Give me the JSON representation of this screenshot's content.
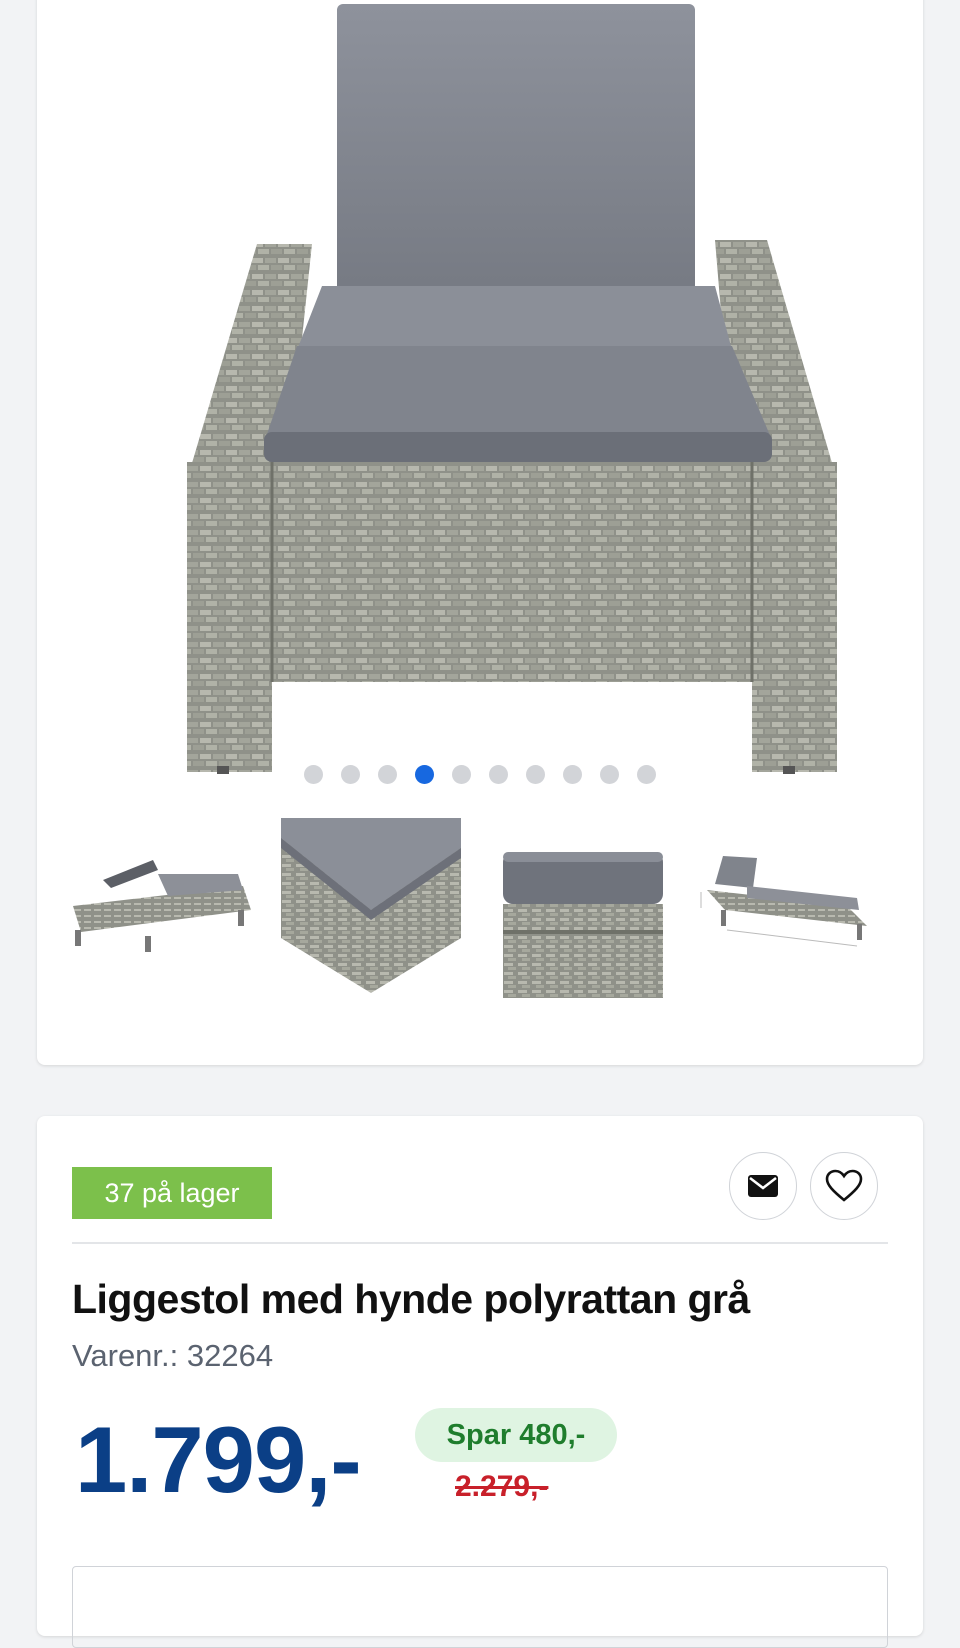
{
  "gallery": {
    "dot_count": 10,
    "active_dot_index": 3,
    "thumbnails": [
      {
        "icon": "lounger-storage-thumbnail"
      },
      {
        "icon": "lounger-corner-thumbnail"
      },
      {
        "icon": "lounger-cushion-closeup-thumbnail"
      },
      {
        "icon": "lounger-dimensions-thumbnail"
      }
    ]
  },
  "product": {
    "stock": "37 på lager",
    "title": "Liggestol med hynde polyrattan grå",
    "sku_label": "Varenr.:",
    "sku_value": "32264",
    "price": "1.799,-",
    "save": "Spar 480,-",
    "old_price": "2.279,-"
  },
  "actions": {
    "email_icon": "envelope-icon",
    "wishlist_icon": "heart-icon"
  },
  "colors": {
    "stock_green": "#7cc04b",
    "price_blue": "#0b3f86",
    "save_bg": "#dff4e2",
    "save_text": "#1f7d2d",
    "old_price_red": "#c8202a",
    "active_dot": "#1768e0"
  }
}
